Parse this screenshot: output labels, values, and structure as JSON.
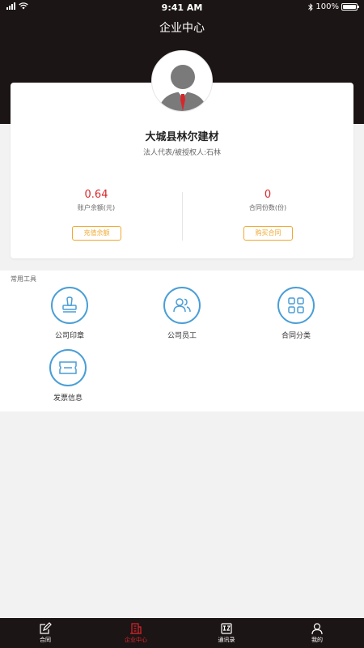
{
  "status_bar": {
    "time": "9:41 AM",
    "battery": "100%",
    "battery_level": 1.0
  },
  "header": {
    "title": "企业中心"
  },
  "company": {
    "name": "大城县林尔建材",
    "legal_rep": "法人代表/被授权人:石林"
  },
  "stats": {
    "balance": {
      "value": "0.64",
      "label": "账户余额(元)",
      "button": "充值余额"
    },
    "contracts": {
      "value": "0",
      "label": "合同份数(份)",
      "button": "购买合同"
    }
  },
  "tools": {
    "title": "常用工具",
    "items": [
      {
        "label": "公司印章",
        "icon": "seal-icon"
      },
      {
        "label": "公司员工",
        "icon": "employees-icon"
      },
      {
        "label": "合同分类",
        "icon": "category-grid-icon"
      },
      {
        "label": "发票信息",
        "icon": "invoice-icon"
      }
    ]
  },
  "tabbar": {
    "items": [
      {
        "label": "合同",
        "icon": "contract-edit-icon",
        "active": false
      },
      {
        "label": "企业中心",
        "icon": "building-icon",
        "active": true
      },
      {
        "label": "通讯录",
        "icon": "contacts-icon",
        "active": false
      },
      {
        "label": "我的",
        "icon": "user-icon",
        "active": false
      }
    ]
  },
  "colors": {
    "header_bg": "#1c1515",
    "accent_red": "#d9262b",
    "button_orange": "#f0a830",
    "icon_blue": "#4a9ed6"
  }
}
